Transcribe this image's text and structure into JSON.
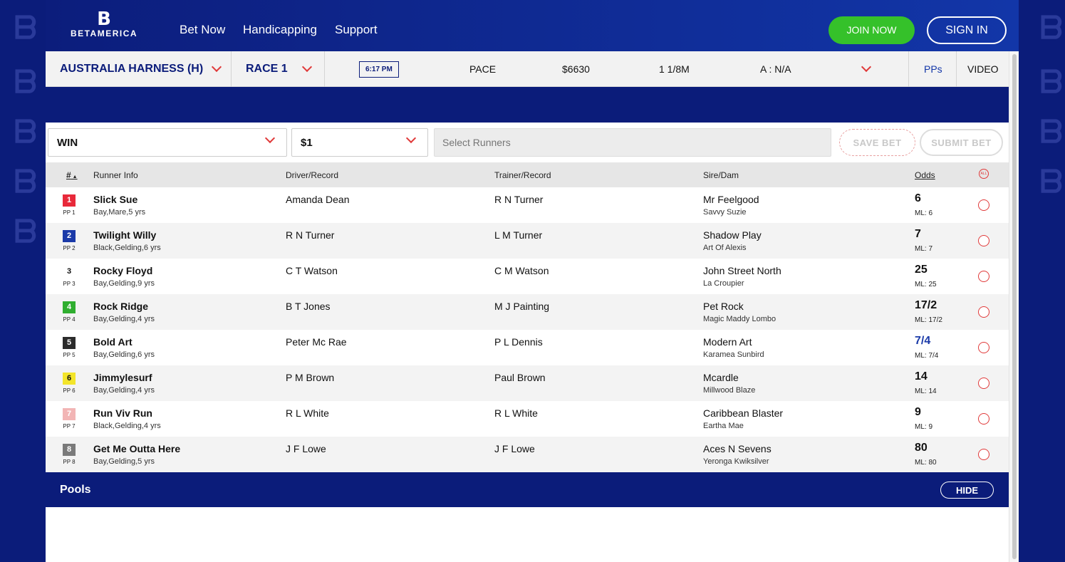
{
  "brand": {
    "name": "BETAMERICA",
    "logo_mark": "B"
  },
  "nav": {
    "bet_now": "Bet Now",
    "handicapping": "Handicapping",
    "support": "Support"
  },
  "auth": {
    "join": "JOIN NOW",
    "signin": "SIGN IN"
  },
  "race": {
    "track": "AUSTRALIA HARNESS (H)",
    "race": "RACE 1",
    "time": "6:17 PM",
    "type": "PACE",
    "purse": "$6630",
    "distance": "1 1/8M",
    "grade": "A : N/A",
    "pps": "PPs",
    "video": "VIDEO"
  },
  "betslip": {
    "bet_type": "WIN",
    "amount": "$1",
    "runners_placeholder": "Select Runners",
    "save": "SAVE BET",
    "submit": "SUBMIT BET"
  },
  "table": {
    "headers": {
      "num": "#",
      "runner": "Runner Info",
      "driver": "Driver/Record",
      "trainer": "Trainer/Record",
      "sire": "Sire/Dam",
      "odds": "Odds",
      "all": "ALL"
    },
    "rows": [
      {
        "num": "1",
        "pp": "PP 1",
        "name": "Slick Sue",
        "desc": "Bay,Mare,5 yrs",
        "driver": "Amanda Dean",
        "trainer": "R N Turner",
        "sire": "Mr Feelgood",
        "dam": "Savvy Suzie",
        "odds": "6",
        "ml": "ML: 6",
        "badge_bg": "#e8293a",
        "badge_fg": "#ffffff",
        "odds_color": "#111111"
      },
      {
        "num": "2",
        "pp": "PP 2",
        "name": "Twilight Willy",
        "desc": "Black,Gelding,6 yrs",
        "driver": "R N Turner",
        "trainer": "L M Turner",
        "sire": "Shadow Play",
        "dam": "Art Of Alexis",
        "odds": "7",
        "ml": "ML: 7",
        "badge_bg": "#1b3aa8",
        "badge_fg": "#ffffff",
        "odds_color": "#111111"
      },
      {
        "num": "3",
        "pp": "PP 3",
        "name": "Rocky Floyd",
        "desc": "Bay,Gelding,9 yrs",
        "driver": "C T Watson",
        "trainer": "C M Watson",
        "sire": "John Street North",
        "dam": "La Croupier",
        "odds": "25",
        "ml": "ML: 25",
        "badge_bg": "#ffffff",
        "badge_fg": "#111111",
        "odds_color": "#111111"
      },
      {
        "num": "4",
        "pp": "PP 4",
        "name": "Rock Ridge",
        "desc": "Bay,Gelding,4 yrs",
        "driver": "B T Jones",
        "trainer": "M J Painting",
        "sire": "Pet Rock",
        "dam": "Magic Maddy Lombo",
        "odds": "17/2",
        "ml": "ML: 17/2",
        "badge_bg": "#2fae2f",
        "badge_fg": "#ffffff",
        "odds_color": "#111111"
      },
      {
        "num": "5",
        "pp": "PP 5",
        "name": "Bold Art",
        "desc": "Bay,Gelding,6 yrs",
        "driver": "Peter Mc Rae",
        "trainer": "P L Dennis",
        "sire": "Modern Art",
        "dam": "Karamea Sunbird",
        "odds": "7/4",
        "ml": "ML: 7/4",
        "badge_bg": "#2b2b2b",
        "badge_fg": "#ffffff",
        "odds_color": "#1a3aa8"
      },
      {
        "num": "6",
        "pp": "PP 6",
        "name": "Jimmylesurf",
        "desc": "Bay,Gelding,4 yrs",
        "driver": "P M Brown",
        "trainer": "Paul Brown",
        "sire": "Mcardle",
        "dam": "Millwood Blaze",
        "odds": "14",
        "ml": "ML: 14",
        "badge_bg": "#f3e52a",
        "badge_fg": "#111111",
        "odds_color": "#111111"
      },
      {
        "num": "7",
        "pp": "PP 7",
        "name": "Run Viv Run",
        "desc": "Black,Gelding,4 yrs",
        "driver": "R L White",
        "trainer": "R L White",
        "sire": "Caribbean Blaster",
        "dam": "Eartha Mae",
        "odds": "9",
        "ml": "ML: 9",
        "badge_bg": "#f2b5b5",
        "badge_fg": "#ffffff",
        "odds_color": "#111111"
      },
      {
        "num": "8",
        "pp": "PP 8",
        "name": "Get Me Outta Here",
        "desc": "Bay,Gelding,5 yrs",
        "driver": "J F Lowe",
        "trainer": "J F Lowe",
        "sire": "Aces N Sevens",
        "dam": "Yeronga Kwiksilver",
        "odds": "80",
        "ml": "ML: 80",
        "badge_bg": "#7a7a7a",
        "badge_fg": "#ffffff",
        "odds_color": "#111111"
      }
    ]
  },
  "pools": {
    "title": "Pools",
    "hide": "HIDE"
  }
}
